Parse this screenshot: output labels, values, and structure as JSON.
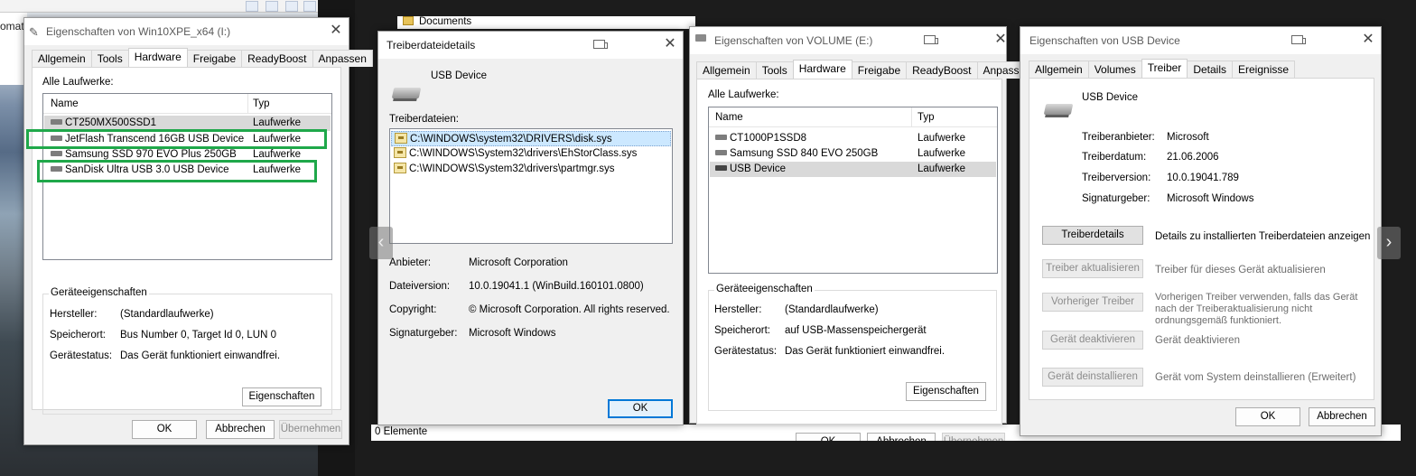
{
  "background": {
    "cut_text": "omat",
    "documents_label": "Documents",
    "statusbar_count": "0 Elemente"
  },
  "win_left": {
    "title": "Eigenschaften von Win10XPE_x64 (I:)",
    "tabs": [
      "Allgemein",
      "Tools",
      "Hardware",
      "Freigabe",
      "ReadyBoost",
      "Anpassen"
    ],
    "active_tab": "Hardware",
    "drives_label": "Alle Laufwerke:",
    "col_name": "Name",
    "col_type": "Typ",
    "rows": [
      {
        "name": "CT250MX500SSD1",
        "type": "Laufwerke"
      },
      {
        "name": "JetFlash Transcend 16GB USB Device",
        "type": "Laufwerke"
      },
      {
        "name": "Samsung SSD 970 EVO Plus 250GB",
        "type": "Laufwerke"
      },
      {
        "name": "SanDisk Ultra USB 3.0 USB Device",
        "type": "Laufwerke"
      }
    ],
    "group_title": "Geräteeigenschaften",
    "props": [
      {
        "label": "Hersteller:",
        "value": "(Standardlaufwerke)"
      },
      {
        "label": "Speicherort:",
        "value": "Bus Number 0, Target Id 0, LUN 0"
      },
      {
        "label": "Gerätestatus:",
        "value": "Das Gerät funktioniert einwandfrei."
      }
    ],
    "properties_button": "Eigenschaften",
    "ok": "OK",
    "cancel": "Abbrechen",
    "apply": "Übernehmen"
  },
  "win_driver_details": {
    "title": "Treiberdateidetails",
    "device_name": "USB Device",
    "files_label": "Treiberdateien:",
    "files": [
      "C:\\WINDOWS\\system32\\DRIVERS\\disk.sys",
      "C:\\WINDOWS\\System32\\drivers\\EhStorClass.sys",
      "C:\\WINDOWS\\System32\\drivers\\partmgr.sys"
    ],
    "info": [
      {
        "label": "Anbieter:",
        "value": "Microsoft Corporation"
      },
      {
        "label": "Dateiversion:",
        "value": "10.0.19041.1 (WinBuild.160101.0800)"
      },
      {
        "label": "Copyright:",
        "value": "© Microsoft Corporation. All rights reserved."
      },
      {
        "label": "Signaturgeber:",
        "value": "Microsoft Windows"
      }
    ],
    "ok": "OK"
  },
  "win_volume": {
    "title": "Eigenschaften von VOLUME (E:)",
    "tabs": [
      "Allgemein",
      "Tools",
      "Hardware",
      "Freigabe",
      "ReadyBoost",
      "Anpassen"
    ],
    "active_tab": "Hardware",
    "drives_label": "Alle Laufwerke:",
    "col_name": "Name",
    "col_type": "Typ",
    "rows": [
      {
        "name": "CT1000P1SSD8",
        "type": "Laufwerke"
      },
      {
        "name": "Samsung SSD 840 EVO 250GB",
        "type": "Laufwerke"
      },
      {
        "name": "USB Device",
        "type": "Laufwerke"
      }
    ],
    "group_title": "Geräteeigenschaften",
    "props": [
      {
        "label": "Hersteller:",
        "value": "(Standardlaufwerke)"
      },
      {
        "label": "Speicherort:",
        "value": "auf USB-Massenspeichergerät"
      },
      {
        "label": "Gerätestatus:",
        "value": "Das Gerät funktioniert einwandfrei."
      }
    ],
    "properties_button": "Eigenschaften",
    "ok": "OK",
    "cancel": "Abbrechen",
    "apply": "Übernehmen"
  },
  "win_usb": {
    "title": "Eigenschaften von USB Device",
    "tabs": [
      "Allgemein",
      "Volumes",
      "Treiber",
      "Details",
      "Ereignisse"
    ],
    "active_tab": "Treiber",
    "device_name": "USB Device",
    "info": [
      {
        "label": "Treiberanbieter:",
        "value": "Microsoft"
      },
      {
        "label": "Treiberdatum:",
        "value": "21.06.2006"
      },
      {
        "label": "Treiberversion:",
        "value": "10.0.19041.789"
      },
      {
        "label": "Signaturgeber:",
        "value": "Microsoft Windows"
      }
    ],
    "actions": [
      {
        "button": "Treiberdetails",
        "desc": "Details zu installierten Treiberdateien anzeigen"
      },
      {
        "button": "Treiber aktualisieren",
        "desc": "Treiber für dieses Gerät aktualisieren"
      },
      {
        "button": "Vorheriger Treiber",
        "desc": "Vorherigen Treiber verwenden, falls das Gerät nach der Treiberaktualisierung nicht ordnungsgemäß funktioniert."
      },
      {
        "button": "Gerät deaktivieren",
        "desc": "Gerät deaktivieren"
      },
      {
        "button": "Gerät deinstallieren",
        "desc": "Gerät vom System deinstallieren (Erweitert)"
      }
    ],
    "ok": "OK",
    "cancel": "Abbrechen"
  }
}
